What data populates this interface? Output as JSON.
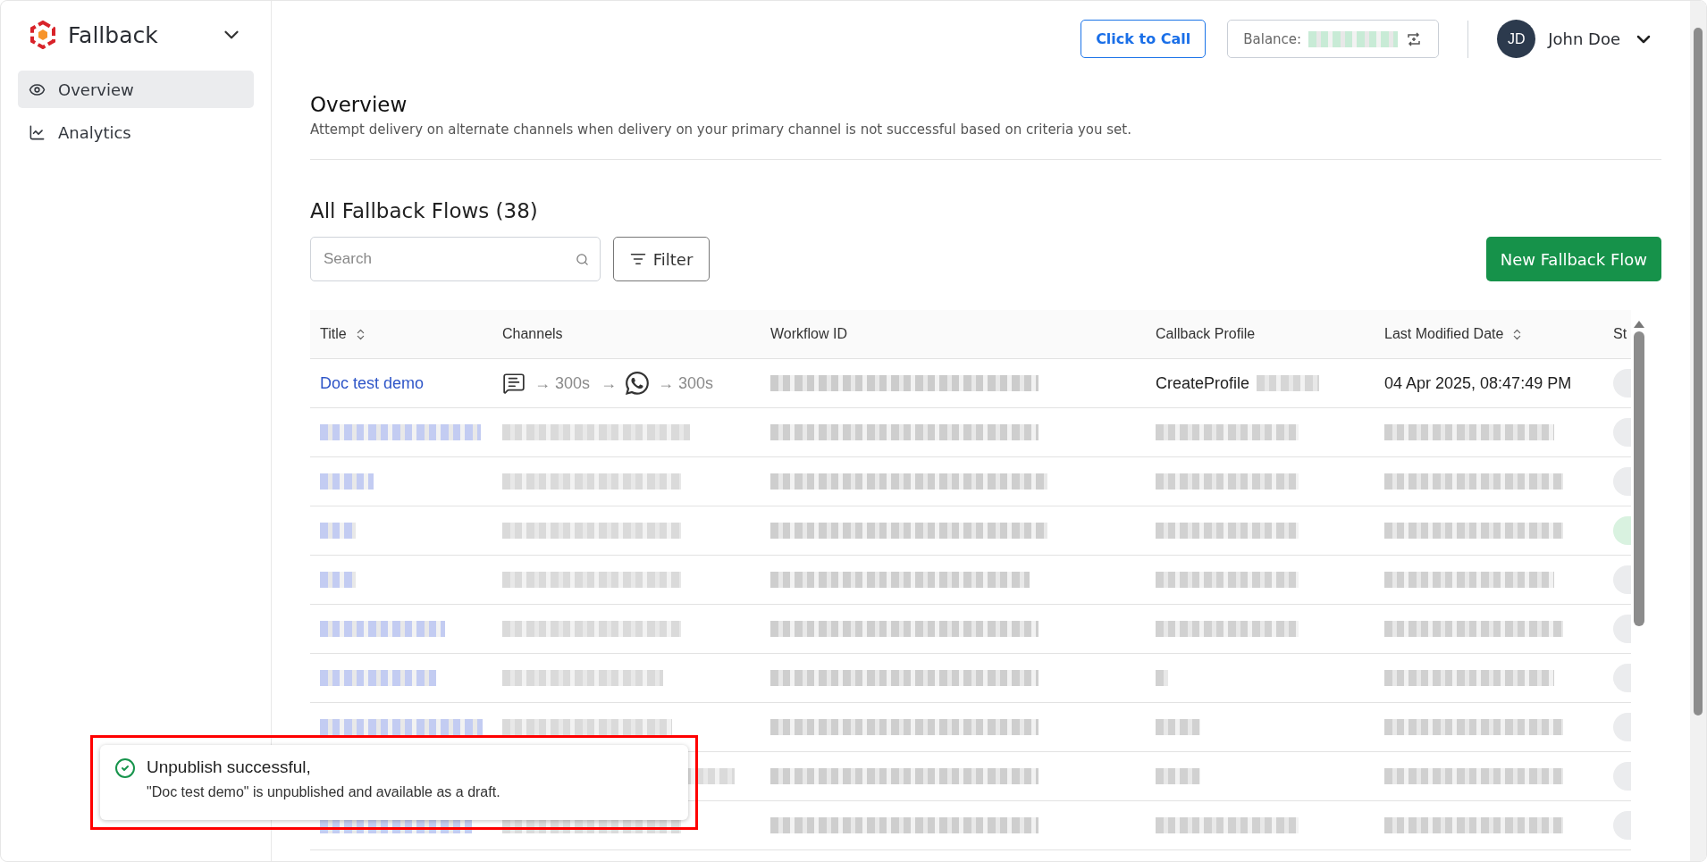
{
  "sidebar": {
    "product": "Fallback",
    "items": [
      {
        "label": "Overview",
        "selected": true
      },
      {
        "label": "Analytics",
        "selected": false
      }
    ]
  },
  "topbar": {
    "call_button": "Click to Call",
    "balance_label": "Balance:",
    "balance_redacted": true,
    "user": {
      "initials": "JD",
      "name": "John Doe"
    }
  },
  "page": {
    "title": "Overview",
    "subtitle": "Attempt delivery on alternate channels when delivery on your primary channel is not successful based on criteria you set.",
    "section_title": "All Fallback Flows (38)"
  },
  "toolbar": {
    "search": {
      "placeholder": "Search"
    },
    "filter_button": "Filter",
    "new_button": "New Fallback Flow"
  },
  "table": {
    "columns": [
      {
        "label": "Title",
        "sortable": true
      },
      {
        "label": "Channels",
        "sortable": false
      },
      {
        "label": "Workflow ID",
        "sortable": false
      },
      {
        "label": "Callback Profile",
        "sortable": false
      },
      {
        "label": "Last Modified Date",
        "sortable": true
      },
      {
        "label": "St"
      }
    ],
    "rows": [
      {
        "kind": "data",
        "title": "Doc test demo",
        "channels": [
          {
            "kind": "message"
          },
          {
            "kind": "delay",
            "arrow": "→",
            "text": "300s"
          },
          {
            "kind": "arrow",
            "arrow": "→"
          },
          {
            "kind": "whatsapp"
          },
          {
            "kind": "delay",
            "arrow": "→",
            "text": "300s"
          }
        ],
        "profile": "CreateProfile",
        "profile_redacted": true,
        "date": "04 Apr 2025, 08:47:49 PM",
        "color": "#ebecee"
      },
      {
        "kind": "redacted",
        "color": "#ebecee"
      },
      {
        "kind": "redacted",
        "color": "#ebecee"
      },
      {
        "kind": "redacted",
        "color": "#d9f2e0"
      },
      {
        "kind": "redacted",
        "color": "#ebecee"
      },
      {
        "kind": "redacted",
        "color": "#ebecee"
      },
      {
        "kind": "redacted",
        "color": "#ebecee"
      },
      {
        "kind": "redacted",
        "color": "#ebecee"
      },
      {
        "kind": "redacted",
        "color": "#ebecee"
      },
      {
        "kind": "redacted",
        "color": "#ebecee"
      }
    ]
  },
  "toast": {
    "title": "Unpublish successful,",
    "message": "\"Doc test demo\" is unpublished and available as a draft.",
    "highlighted": true
  }
}
